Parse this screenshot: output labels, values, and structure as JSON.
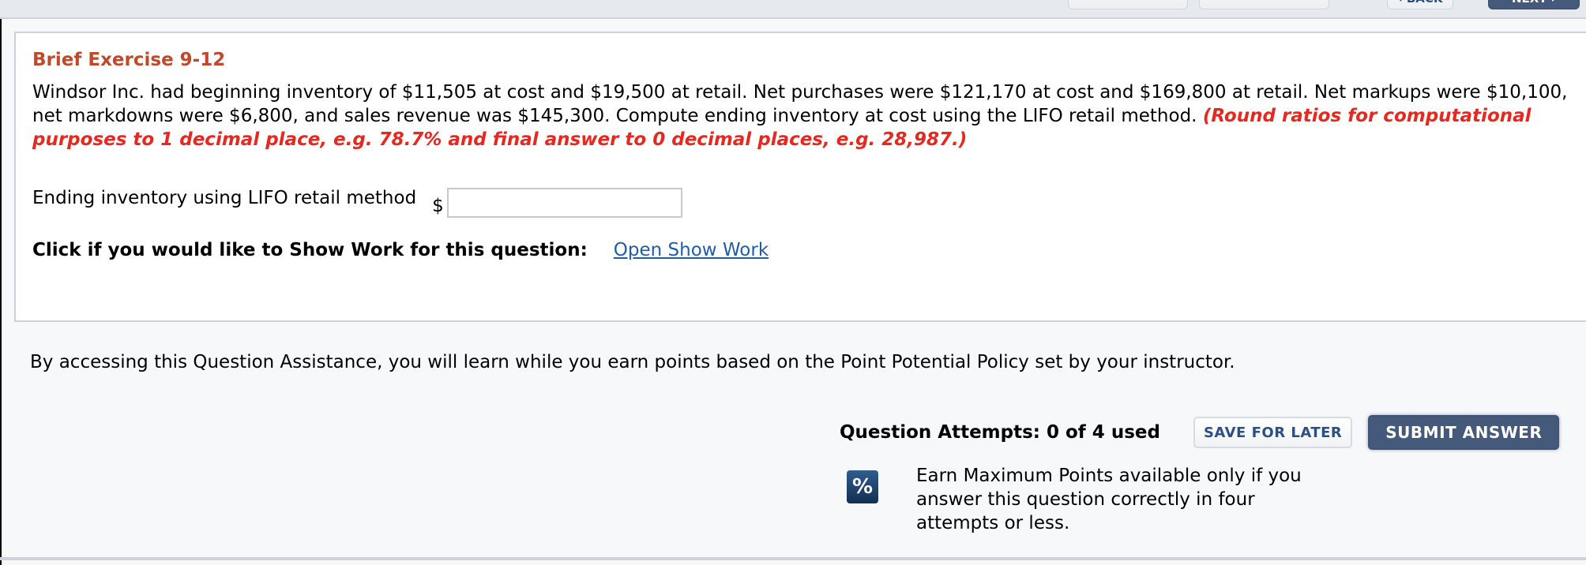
{
  "topbar": {
    "buttons": [
      {
        "label": ""
      },
      {
        "label": ""
      },
      {
        "label": "‹ BACK"
      },
      {
        "label": "NEXT ›"
      }
    ]
  },
  "question": {
    "title": "Brief Exercise 9-12",
    "body": "Windsor Inc. had beginning inventory of $11,505 at cost and $19,500 at retail. Net purchases were $121,170 at cost and $169,800 at retail. Net markups were $10,100, net markdowns were $6,800, and sales revenue was $145,300. Compute ending inventory at cost using the LIFO retail method. ",
    "note": "(Round ratios for computational purposes to 1 decimal place, e.g. 78.7% and final answer to 0 decimal places, e.g. 28,987.)"
  },
  "answer": {
    "label": "Ending inventory using LIFO retail method",
    "currency": "$",
    "value": "",
    "placeholder": ""
  },
  "show_work": {
    "label": "Click if you would like to Show Work for this question:",
    "link": "Open Show Work"
  },
  "assistance": {
    "text": "By accessing this Question Assistance, you will learn while you earn points based on the Point Potential Policy set by your instructor."
  },
  "attempts": {
    "label": "Question Attempts: 0 of 4 used",
    "used": 0,
    "total": 4,
    "save_label": "SAVE FOR LATER",
    "submit_label": "SUBMIT ANSWER"
  },
  "max_points": {
    "icon": "percent-icon",
    "icon_glyph": "%",
    "text": "Earn Maximum Points available only if you answer this question correctly in four attempts or less."
  },
  "colors": {
    "title": "#c0492b",
    "note": "#e8271f",
    "link": "#1f5ea8",
    "submit_bg": "#45597a",
    "save_text": "#2c4f86"
  }
}
